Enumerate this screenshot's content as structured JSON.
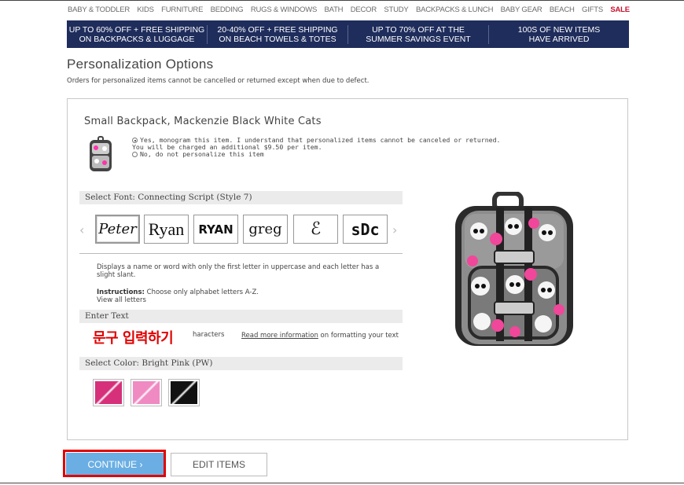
{
  "nav": {
    "items": [
      "BABY & TODDLER",
      "KIDS",
      "FURNITURE",
      "BEDDING",
      "RUGS & WINDOWS",
      "BATH",
      "DECOR",
      "STUDY",
      "BACKPACKS & LUNCH",
      "BABY GEAR",
      "BEACH",
      "GIFTS",
      "SALE"
    ]
  },
  "promos": [
    {
      "line1": "UP TO 60% OFF + FREE SHIPPING",
      "line2": "ON BACKPACKS & LUGGAGE"
    },
    {
      "line1": "20-40% OFF + FREE SHIPPING",
      "line2": "ON BEACH TOWELS & TOTES"
    },
    {
      "line1": "UP TO 70% OFF AT THE",
      "line2": "SUMMER SAVINGS EVENT"
    },
    {
      "line1": "100s OF NEW ITEMS",
      "line2": "HAVE ARRIVED"
    }
  ],
  "page": {
    "title": "Personalization Options",
    "subtitle": "Orders for personalized items cannot be cancelled or returned except when due to defect."
  },
  "product": {
    "name": "Small Backpack, Mackenzie Black White Cats",
    "option_yes_line1": "Yes, monogram this item. I understand that personalized items cannot be canceled or returned.",
    "option_yes_line2": "You will be charged an additional $9.50 per item.",
    "option_no": "No, do not personalize this item"
  },
  "font_section": {
    "label": "Select Font: Connecting Script (Style 7)",
    "tiles": [
      "Peter",
      "Ryan",
      "RYAN",
      "greg",
      "ℰ",
      "sDc"
    ],
    "description": "Displays a name or word with only the first letter in uppercase and each letter has a slight slant.",
    "instructions_label": "Instructions:",
    "instructions_text": "Choose only alphabet letters A-Z.",
    "view_all": "View all letters"
  },
  "text_section": {
    "label": "Enter Text",
    "overlay_text": "문구 입력하기",
    "chars_partial": "haracters",
    "read_more_link": "Read more information",
    "read_more_rest": "on formatting your text"
  },
  "color_section": {
    "label": "Select Color: Bright Pink (PW)",
    "swatches": [
      "#d6307a",
      "#f08ac2",
      "#111111"
    ]
  },
  "buttons": {
    "continue": "CONTINUE ›",
    "edit": "EDIT ITEMS"
  },
  "colors": {
    "promo_bg": "#1f2d5c",
    "continue_bg": "#6aaee3",
    "highlight": "#e10000",
    "sale": "#c8102e"
  }
}
